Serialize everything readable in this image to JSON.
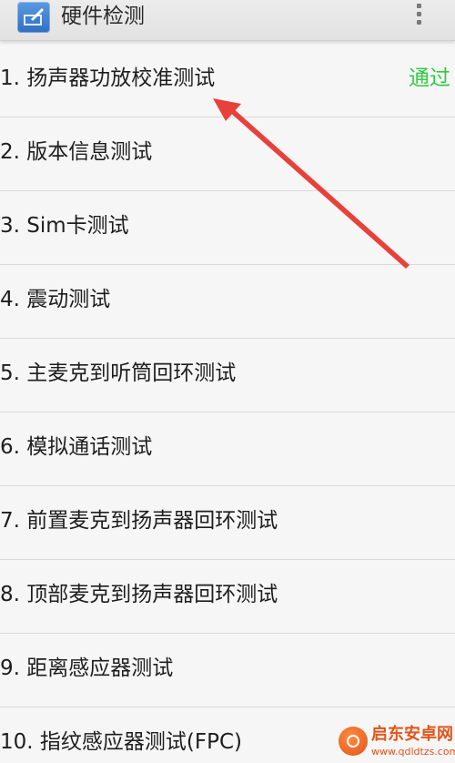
{
  "action_bar": {
    "title": "硬件检测",
    "app_icon": "hardware-test-app-icon",
    "menu_icon": "overflow-menu-icon"
  },
  "tests": [
    {
      "label": "1. 扬声器功放校准测试",
      "status": "通过"
    },
    {
      "label": "2. 版本信息测试",
      "status": ""
    },
    {
      "label": "3. Sim卡测试",
      "status": ""
    },
    {
      "label": "4. 震动测试",
      "status": ""
    },
    {
      "label": "5. 主麦克到听筒回环测试",
      "status": ""
    },
    {
      "label": "6. 模拟通话测试",
      "status": ""
    },
    {
      "label": "7. 前置麦克到扬声器回环测试",
      "status": ""
    },
    {
      "label": "8. 顶部麦克到扬声器回环测试",
      "status": ""
    },
    {
      "label": "9. 距离感应器测试",
      "status": ""
    },
    {
      "label": "10. 指纹感应器测试(FPC)",
      "status": ""
    }
  ],
  "colors": {
    "pass_status": "#2ecc40",
    "annotation_arrow": "#e8413a",
    "watermark": "#e2541b"
  },
  "watermark": {
    "name": "启东安卓网",
    "url": "www.qdldtzs.com"
  }
}
